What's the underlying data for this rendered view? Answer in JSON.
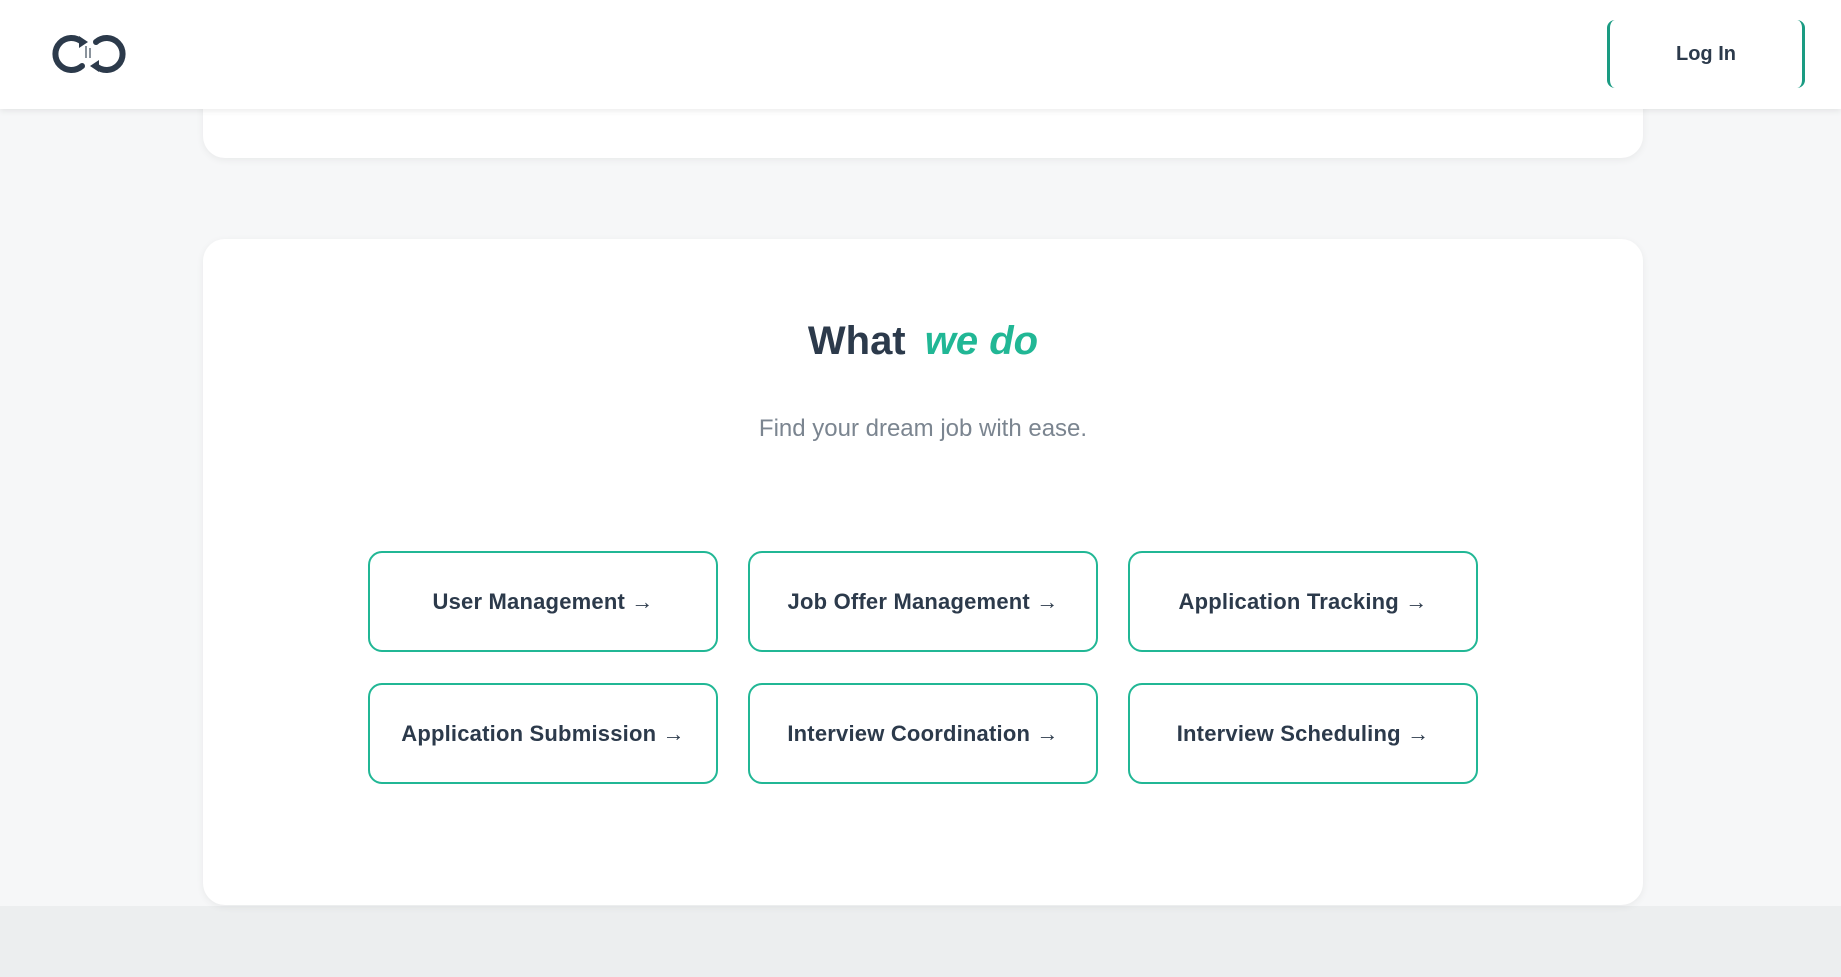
{
  "header": {
    "logo_icon": "brand-logo-icon",
    "login_label": "Log In"
  },
  "section": {
    "title_main": "What",
    "title_accent": "we do",
    "subtitle": "Find your dream job with ease.",
    "services": [
      {
        "label": "User Management →"
      },
      {
        "label": "Job Offer Management →"
      },
      {
        "label": "Application Tracking →"
      },
      {
        "label": "Application Submission →"
      },
      {
        "label": "Interview Coordination →"
      },
      {
        "label": "Interview Scheduling →"
      }
    ]
  },
  "colors": {
    "accent": "#21b795",
    "dark_text": "#2c3a4b",
    "muted_text": "#7b8590",
    "page_bg": "#f6f7f8"
  }
}
